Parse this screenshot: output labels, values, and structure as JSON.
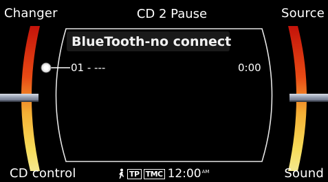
{
  "softkeys": {
    "top_left": "Changer",
    "top_right": "Source",
    "bottom_left": "CD control",
    "bottom_right": "Sound"
  },
  "header": {
    "title": "CD 2 Pause"
  },
  "source": {
    "label": "BlueTooth-no connect"
  },
  "track": {
    "label": "01 - ---",
    "time": "0:00"
  },
  "status": {
    "tp": "TP",
    "tmc": "TMC",
    "clock": "12:00",
    "ampm": "AM",
    "icon": "traffic-person-icon"
  },
  "colors": {
    "background": "#000000",
    "text": "#ffffff",
    "arc_red": "#e02010",
    "arc_orange": "#f08a1a",
    "arc_yellow": "#f6d84a"
  }
}
